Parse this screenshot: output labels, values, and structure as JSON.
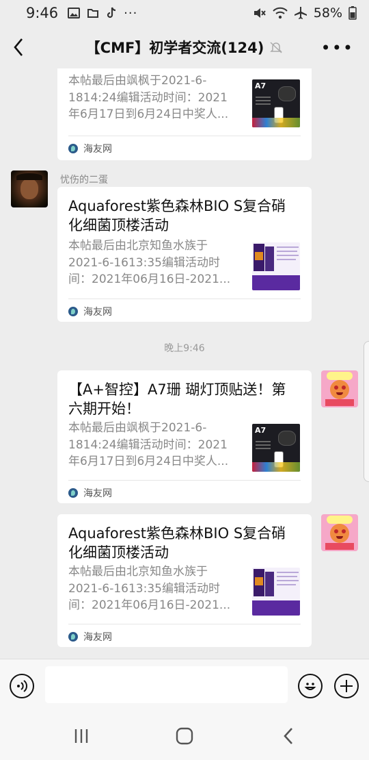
{
  "status": {
    "time": "9:46",
    "left_icons": [
      "image-icon",
      "folder-icon",
      "tiktok-icon",
      "more-dots-icon"
    ],
    "battery_text": "58%"
  },
  "header": {
    "title": "【CMF】初学者交流(124)"
  },
  "cards": [
    {
      "title": "",
      "desc": "本帖最后由飒枫于2021-6-1814:24编辑活动时间：2021年6月17日到6月24日中奖人...",
      "thumb": "a7-light-thumbnail",
      "thumb_text": "A7",
      "source": "海友网"
    },
    {
      "title": "Aquaforest紫色森林BIO S复合硝化细菌顶楼活动",
      "desc": "本帖最后由北京知鱼水族于2021-6-1613:35编辑活动时间：2021年06月16日-2021...",
      "thumb": "aquaforest-bottle-thumbnail",
      "source": "海友网"
    },
    {
      "title": "【A+智控】A7珊 瑚灯顶贴送！第六期开始！",
      "desc": "本帖最后由飒枫于2021-6-1814:24编辑活动时间：2021年6月17日到6月24日中奖人...",
      "thumb": "a7-light-thumbnail",
      "thumb_text": "A7",
      "source": "海友网"
    },
    {
      "title": "Aquaforest紫色森林BIO S复合硝化细菌顶楼活动",
      "desc": "本帖最后由北京知鱼水族于2021-6-1613:35编辑活动时间：2021年06月16日-2021...",
      "thumb": "aquaforest-bottle-thumbnail",
      "source": "海友网"
    }
  ],
  "messages": {
    "sender_name": "忧伤的二蛋",
    "timestamp": "晚上9:46"
  },
  "colors": {
    "background": "#ededed",
    "card": "#ffffff",
    "muted_text": "#888888"
  }
}
